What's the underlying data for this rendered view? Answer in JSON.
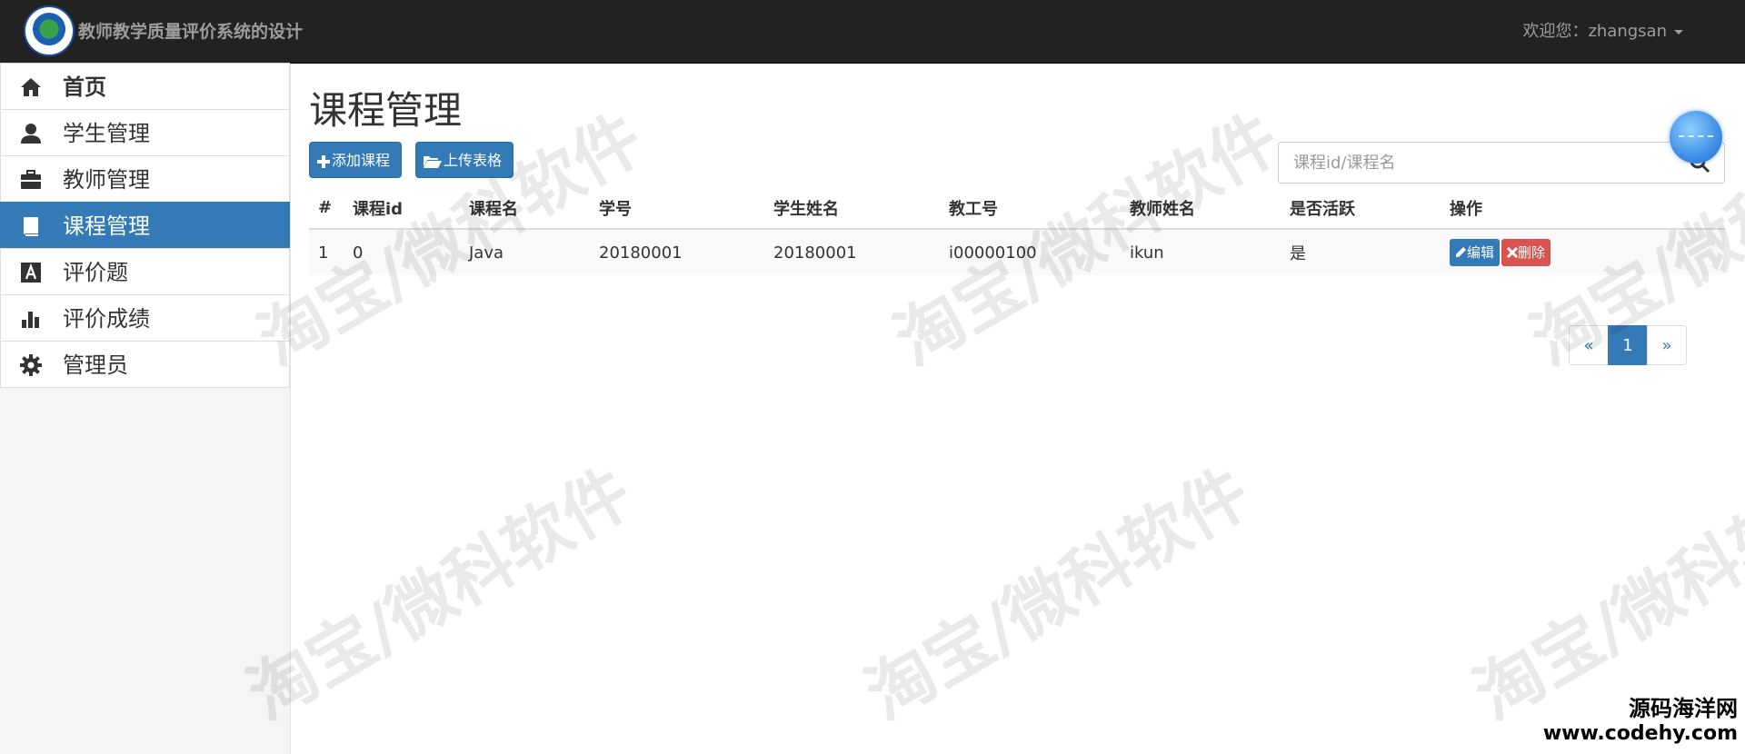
{
  "app": {
    "title": "教师教学质量评价系统的设计"
  },
  "user": {
    "greeting": "欢迎您：zhangsan"
  },
  "sidebar": {
    "items": [
      {
        "label": "首页",
        "icon": "home-icon"
      },
      {
        "label": "学生管理",
        "icon": "user-icon"
      },
      {
        "label": "教师管理",
        "icon": "briefcase-icon"
      },
      {
        "label": "课程管理",
        "icon": "book-icon",
        "active": true
      },
      {
        "label": "评价题",
        "icon": "font-icon"
      },
      {
        "label": "评价成绩",
        "icon": "stats-icon"
      },
      {
        "label": "管理员",
        "icon": "cog-icon"
      }
    ]
  },
  "page": {
    "title": "课程管理"
  },
  "toolbar": {
    "add_label": "添加课程",
    "upload_label": "上传表格"
  },
  "search": {
    "placeholder": "课程id/课程名"
  },
  "table": {
    "headers": [
      "#",
      "课程id",
      "课程名",
      "学号",
      "学生姓名",
      "教工号",
      "教师姓名",
      "是否活跃",
      "操作"
    ],
    "rows": [
      {
        "cells": [
          "1",
          "0",
          "Java",
          "20180001",
          "20180001",
          "i00000100",
          "ikun",
          "是"
        ],
        "edit": "编辑",
        "delete": "删除"
      }
    ]
  },
  "pagination": {
    "prev": "«",
    "current": "1",
    "next": "»"
  },
  "watermark": {
    "text": "淘宝/微科软件"
  },
  "corner_mark": {
    "line1": "源码海洋网",
    "line2": "www.codehy.com"
  },
  "colors": {
    "navbar": "#222222",
    "primary": "#337ab7",
    "danger": "#d9534f"
  }
}
